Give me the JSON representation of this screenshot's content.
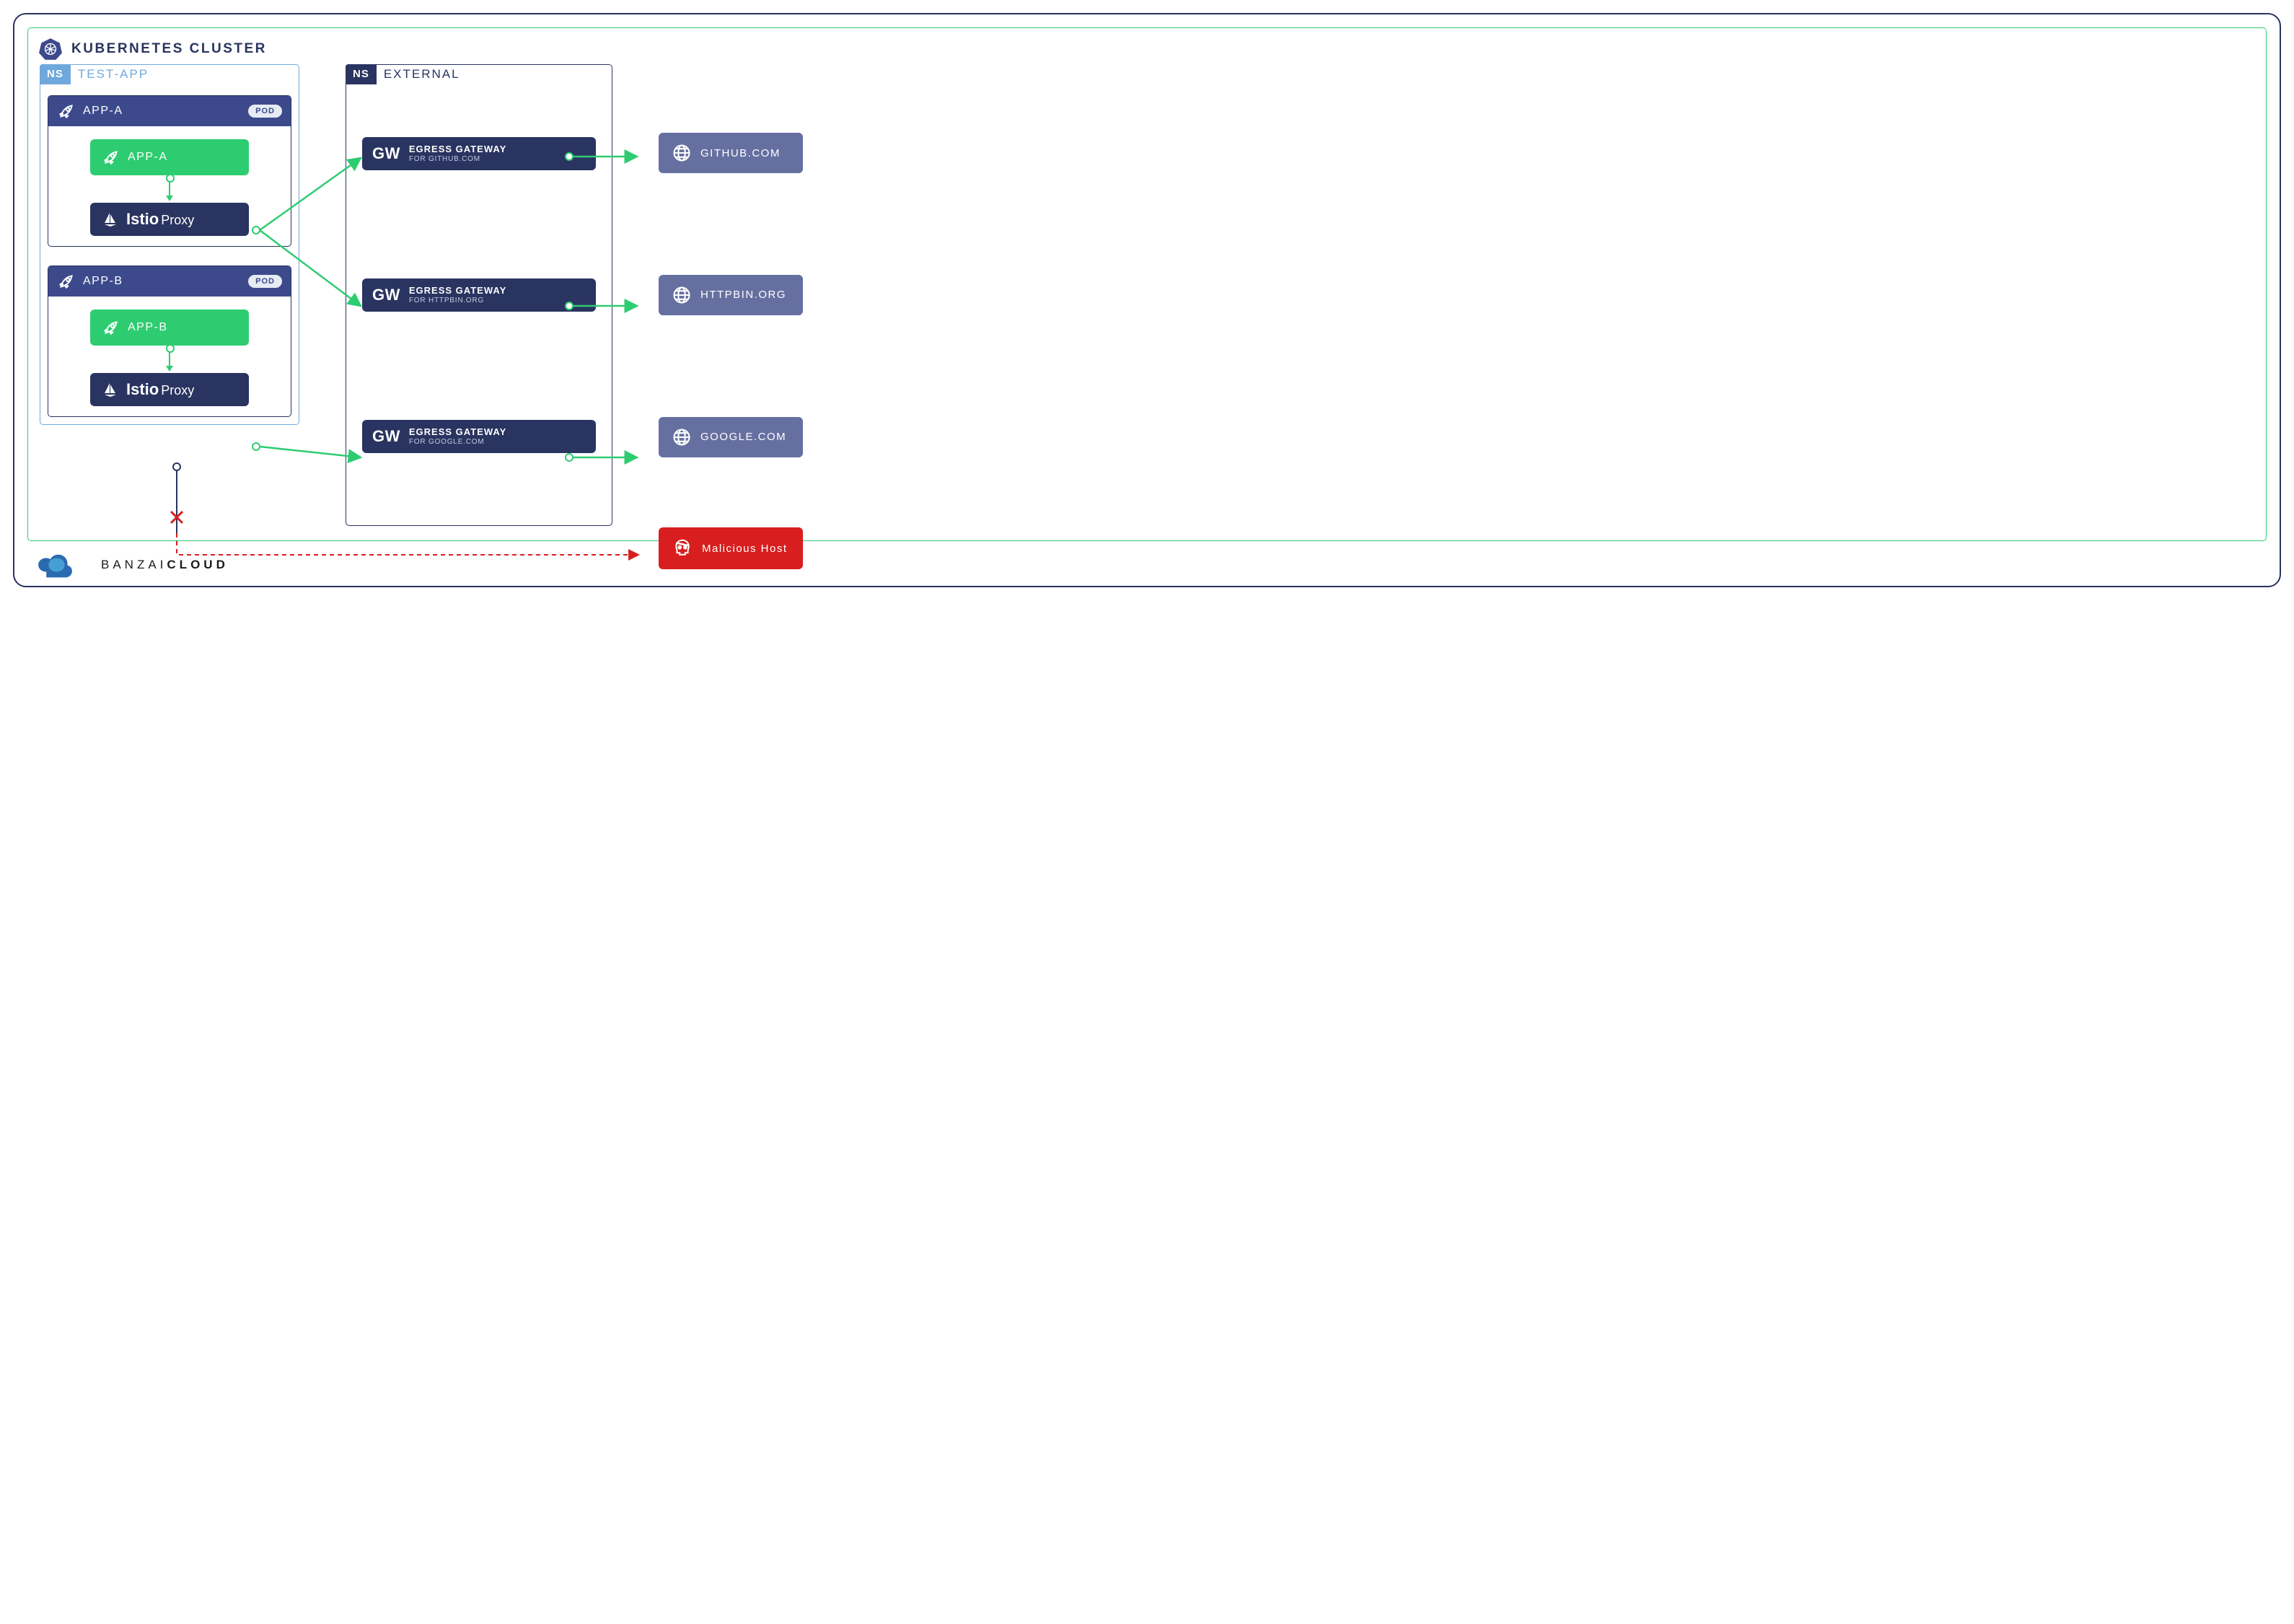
{
  "cluster": {
    "title": "KUBERNETES CLUSTER"
  },
  "ns1": {
    "badge": "NS",
    "name": "TEST-APP",
    "podA": {
      "title": "APP-A",
      "pill": "POD",
      "app": "APP-A",
      "proxy_bold": "Istio",
      "proxy_light": "Proxy"
    },
    "podB": {
      "title": "APP-B",
      "pill": "POD",
      "app": "APP-B",
      "proxy_bold": "Istio",
      "proxy_light": "Proxy"
    }
  },
  "ns2": {
    "badge": "NS",
    "name": "EXTERNAL",
    "gw1": {
      "label": "GW",
      "t1": "EGRESS GATEWAY",
      "t2": "FOR GITHUB.COM"
    },
    "gw2": {
      "label": "GW",
      "t1": "EGRESS GATEWAY",
      "t2": "FOR HTTPBIN.ORG"
    },
    "gw3": {
      "label": "GW",
      "t1": "EGRESS GATEWAY",
      "t2": "FOR GOOGLE.COM"
    }
  },
  "ext": {
    "e1": "GITHUB.COM",
    "e2": "HTTPBIN.ORG",
    "e3": "GOOGLE.COM",
    "mal": "Malicious Host"
  },
  "footer": {
    "b": "BANZAI",
    "c": "CLOUD"
  },
  "colors": {
    "green": "#2ecc71",
    "navy": "#2a3460",
    "midblue": "#3c4a8c",
    "slate": "#6670a0",
    "red": "#d81e1e",
    "lightblue": "#6fa8dc"
  }
}
